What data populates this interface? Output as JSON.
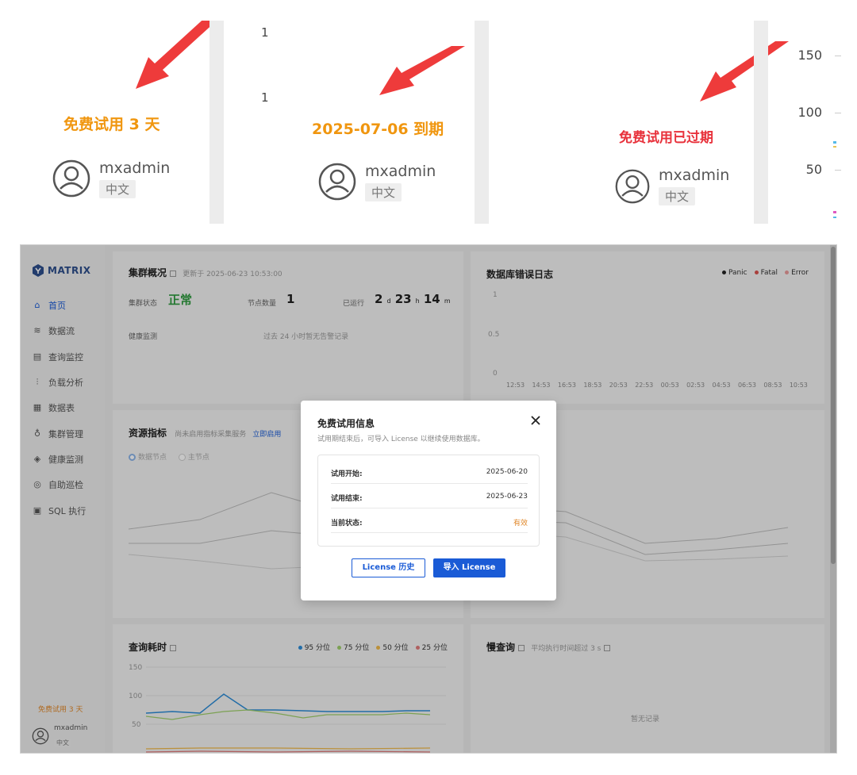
{
  "top_strip": {
    "panel1": {
      "trial_text": "免费试用 3 天",
      "trial_color": "#f0960f",
      "username": "mxadmin",
      "lang": "中文"
    },
    "panel2": {
      "frag_nums": [
        "1",
        "1"
      ],
      "trial_text": "2025-07-06 到期",
      "trial_color": "#f0960f",
      "username": "mxadmin",
      "lang": "中文"
    },
    "panel3": {
      "trial_text": "免费试用已过期",
      "trial_color": "#e8323c",
      "username": "mxadmin",
      "lang": "中文"
    },
    "axis_fragment": {
      "ticks": [
        "150",
        "100",
        "50"
      ]
    }
  },
  "app": {
    "logo": "MATRIX",
    "nav": [
      {
        "label": "首页",
        "icon": "home-icon",
        "active": true
      },
      {
        "label": "数据流",
        "icon": "dataflow-icon"
      },
      {
        "label": "查询监控",
        "icon": "sql-monitor-icon"
      },
      {
        "label": "负载分析",
        "icon": "bar-chart-icon"
      },
      {
        "label": "数据表",
        "icon": "table-icon"
      },
      {
        "label": "集群管理",
        "icon": "cluster-icon"
      },
      {
        "label": "健康监测",
        "icon": "shield-icon"
      },
      {
        "label": "自助巡检",
        "icon": "inspect-icon"
      },
      {
        "label": "SQL 执行",
        "icon": "sql-exec-icon"
      }
    ],
    "sidebar_trial": "免费试用 3 天",
    "sidebar_user": {
      "username": "mxadmin",
      "lang": "中文"
    },
    "cluster_card": {
      "title": "集群概况",
      "updated": "更新于 2025-06-23 10:53:00",
      "status_label": "集群状态",
      "status_value": "正常",
      "nodes_label": "节点数量",
      "nodes_value": "1",
      "uptime_label": "已运行",
      "uptime_d": "2",
      "uptime_d_unit": "d",
      "uptime_h": "23",
      "uptime_h_unit": "h",
      "uptime_m": "14",
      "uptime_m_unit": "m",
      "health_label": "健康监测",
      "health_text": "过去 24 小时暂无告警记录"
    },
    "db_error_card": {
      "title": "数据库错误日志",
      "legend": [
        "Panic",
        "Fatal",
        "Error"
      ],
      "legend_colors": [
        "#222222",
        "#d9534f",
        "#e89a9a"
      ],
      "y_ticks": [
        "1",
        "0.5",
        "0"
      ],
      "x_ticks": [
        "12:53",
        "14:53",
        "16:53",
        "18:53",
        "20:53",
        "22:53",
        "00:53",
        "02:53",
        "04:53",
        "06:53",
        "08:53",
        "10:53"
      ]
    },
    "resource_card": {
      "title": "资源指标",
      "note": "尚未启用指标采集服务",
      "link": "立即启用",
      "radio_1": "数据节点",
      "radio_2": "主节点"
    },
    "query_card": {
      "title": "查询耗时",
      "legend": [
        "95 分位",
        "75 分位",
        "50 分位",
        "25 分位"
      ],
      "legend_colors": [
        "#2b8bd6",
        "#9fcf6b",
        "#f0b94a",
        "#e07a7a"
      ],
      "y_ticks": [
        "150",
        "100",
        "50"
      ]
    },
    "slow_card": {
      "title": "慢查询",
      "note": "平均执行时间超过 3 s",
      "empty": "暂无记录"
    },
    "modal": {
      "title": "免费试用信息",
      "subtitle": "试用期结束后，可导入 License 以继续使用数据库。",
      "rows": [
        {
          "k": "试用开始:",
          "v": "2025-06-20"
        },
        {
          "k": "试用结束:",
          "v": "2025-06-23"
        },
        {
          "k": "当前状态:",
          "v": "有效"
        }
      ],
      "btn_history": "License 历史",
      "btn_import": "导入 License"
    }
  }
}
